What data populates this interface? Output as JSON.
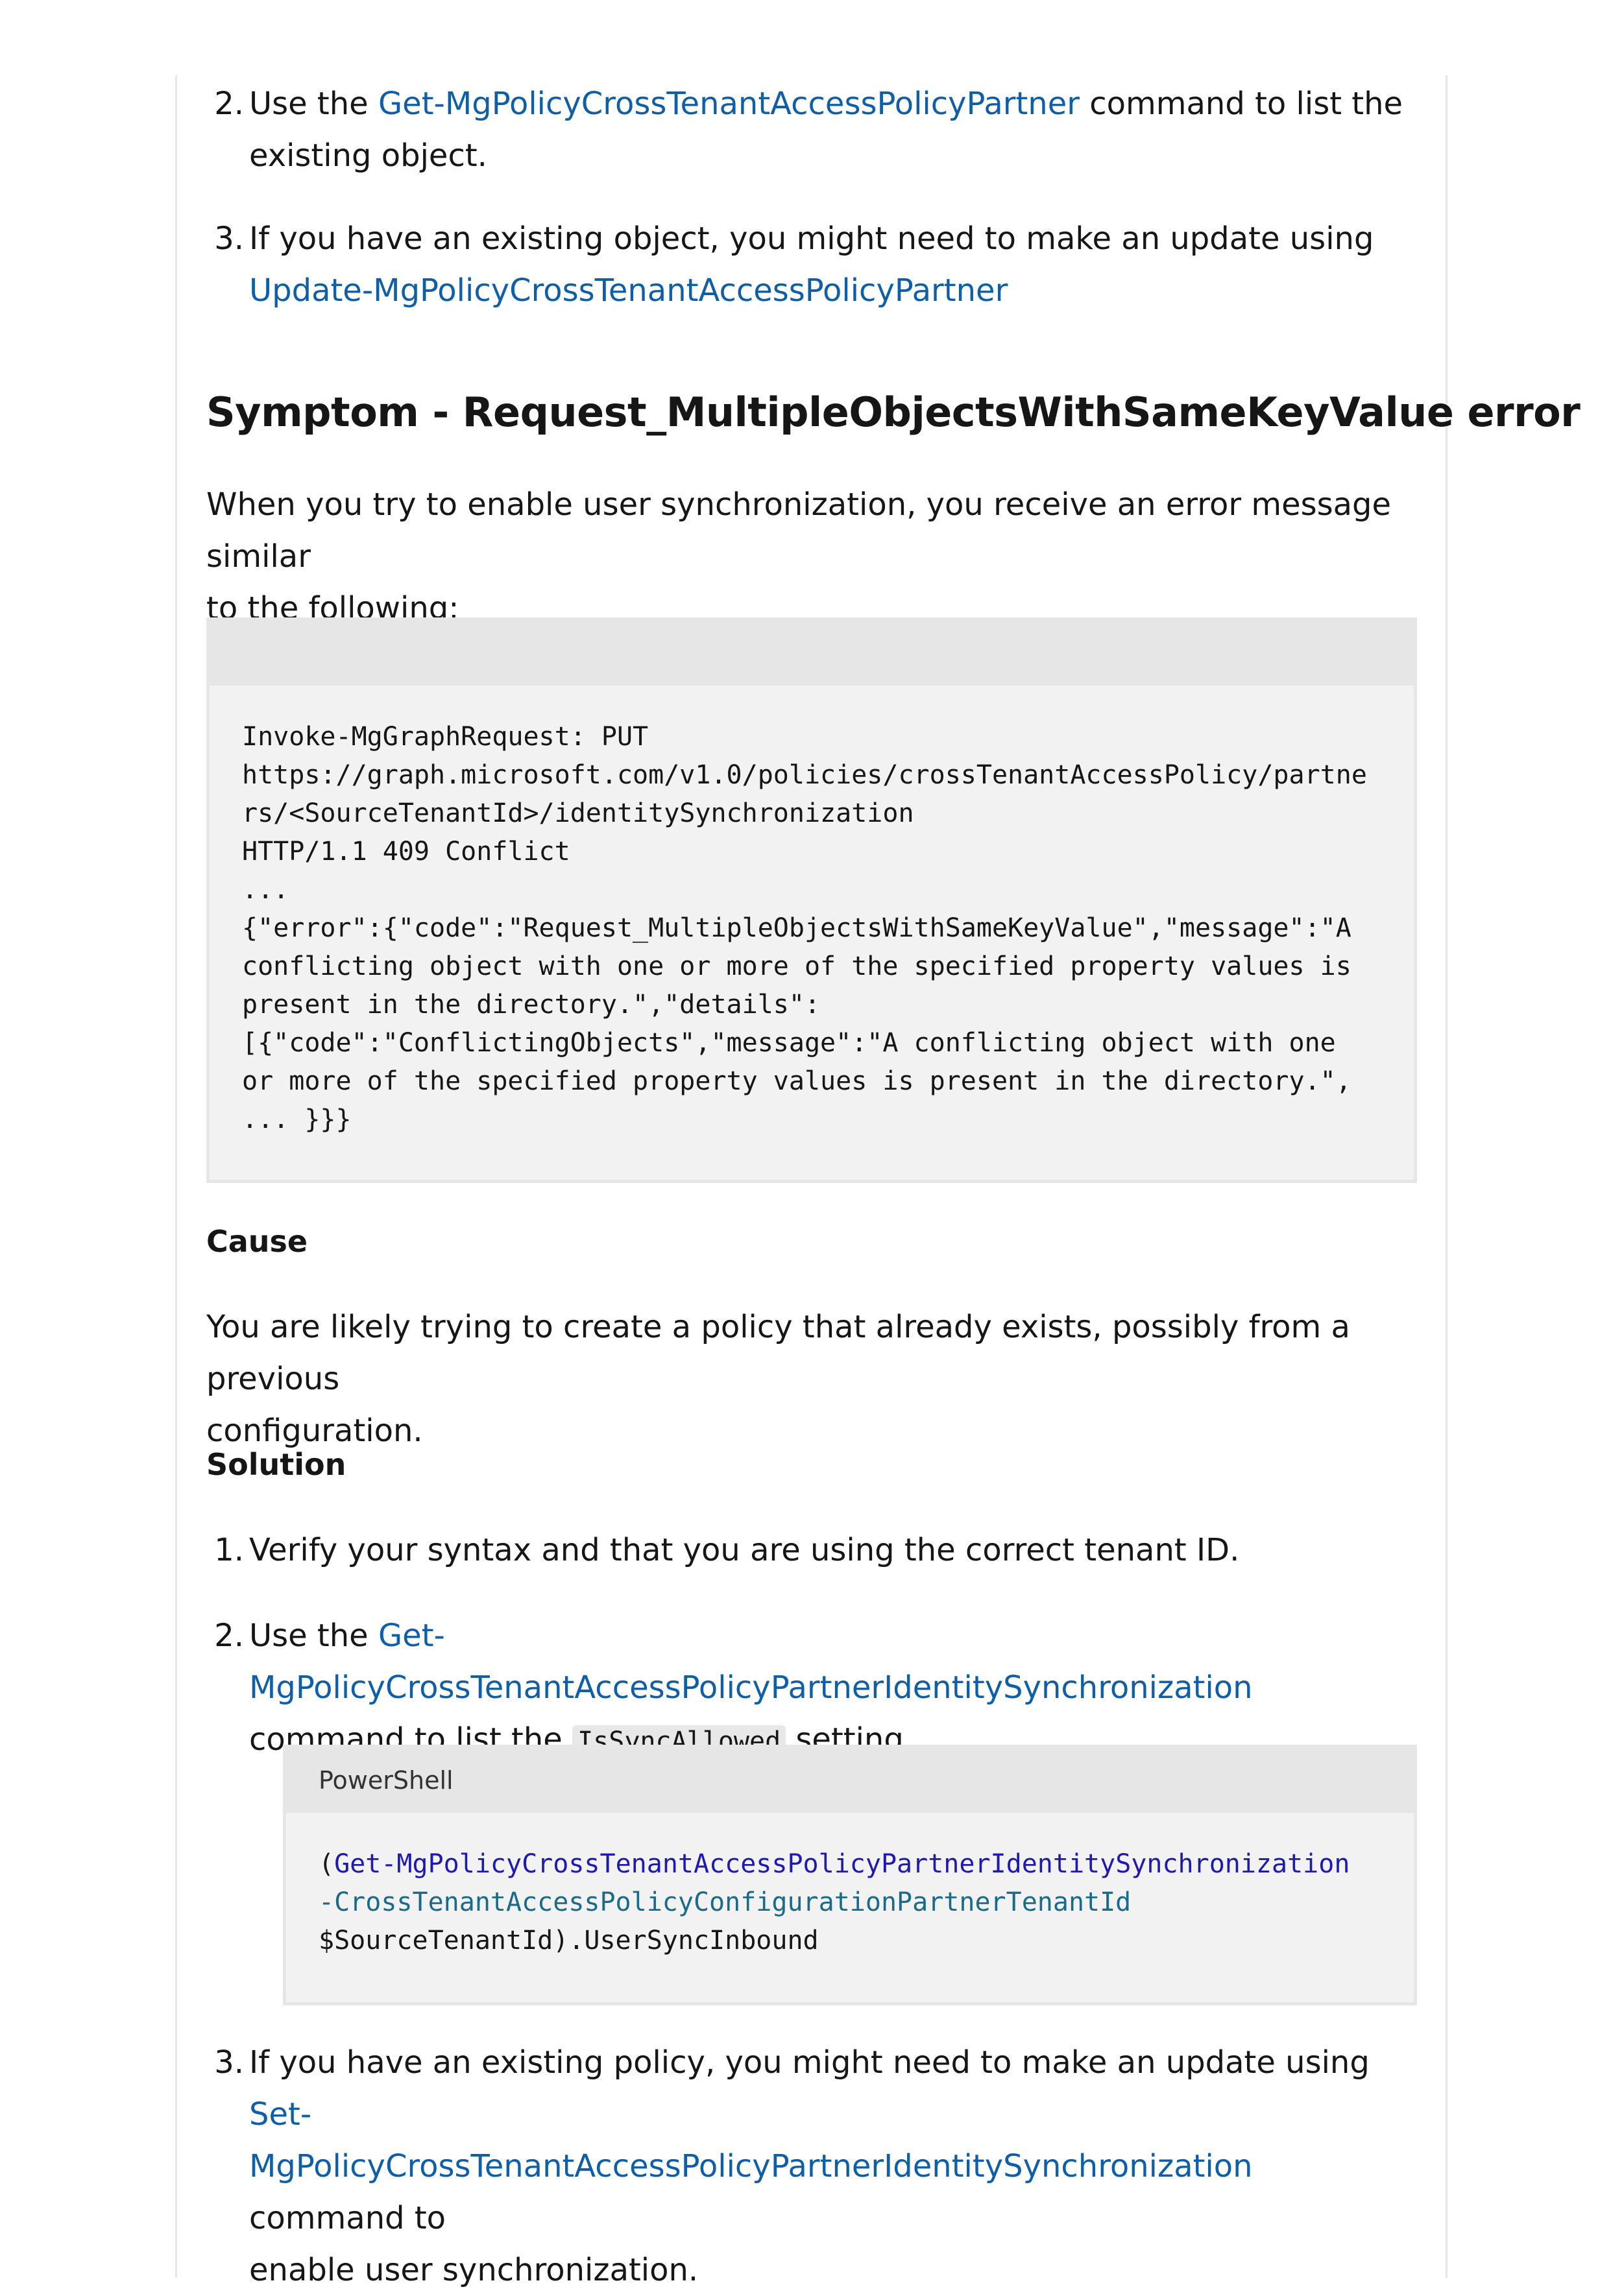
{
  "top_list": {
    "item2": {
      "num": "2.",
      "pre": "Use the ",
      "link": "Get-MgPolicyCrossTenantAccessPolicyPartner",
      "post_line1": " command to list the",
      "line2": "existing object."
    },
    "item3": {
      "num": "3.",
      "line1": "If you have an existing object, you might need to make an update using",
      "link": "Update-MgPolicyCrossTenantAccessPolicyPartner"
    }
  },
  "heading": "Symptom - Request_MultipleObjectsWithSameKeyValue error",
  "intro": {
    "line1": "When you try to enable user synchronization, you receive an error message similar",
    "line2": "to the following:"
  },
  "error_code_block": {
    "header": "",
    "lines": [
      "Invoke-MgGraphRequest: PUT",
      "https://graph.microsoft.com/v1.0/policies/crossTenantAccessPolicy/partne",
      "rs/<SourceTenantId>/identitySynchronization",
      "HTTP/1.1 409 Conflict",
      "...",
      "{\"error\":{\"code\":\"Request_MultipleObjectsWithSameKeyValue\",\"message\":\"A",
      "conflicting object with one or more of the specified property values is",
      "present in the directory.\",\"details\":",
      "[{\"code\":\"ConflictingObjects\",\"message\":\"A conflicting object with one",
      "or more of the specified property values is present in the directory.\",",
      "... }}}"
    ]
  },
  "cause": {
    "heading": "Cause",
    "line1": "You are likely trying to create a policy that already exists, possibly from a previous",
    "line2": "configuration."
  },
  "solution": {
    "heading": "Solution",
    "item1": {
      "num": "1.",
      "text": "Verify your syntax and that you are using the correct tenant ID."
    },
    "item2": {
      "num": "2.",
      "pre": "Use the ",
      "link": "Get-MgPolicyCrossTenantAccessPolicyPartnerIdentitySynchronization",
      "line2_pre": "command to list the ",
      "inline_code": "IsSyncAllowed",
      "line2_post": " setting."
    },
    "powershell_block": {
      "header": "PowerShell",
      "open_paren": "(",
      "cmd": "Get-MgPolicyCrossTenantAccessPolicyPartnerIdentitySynchronization",
      "param": "-CrossTenantAccessPolicyConfigurationPartnerTenantId",
      "line3": "$SourceTenantId).UserSyncInbound"
    },
    "item3": {
      "num": "3.",
      "pre": "If you have an existing policy, you might need to make an update using ",
      "link_part1": "Set-",
      "link_part2": "MgPolicyCrossTenantAccessPolicyPartnerIdentitySynchronization",
      "post": " command to",
      "line3": "enable user synchronization."
    }
  }
}
